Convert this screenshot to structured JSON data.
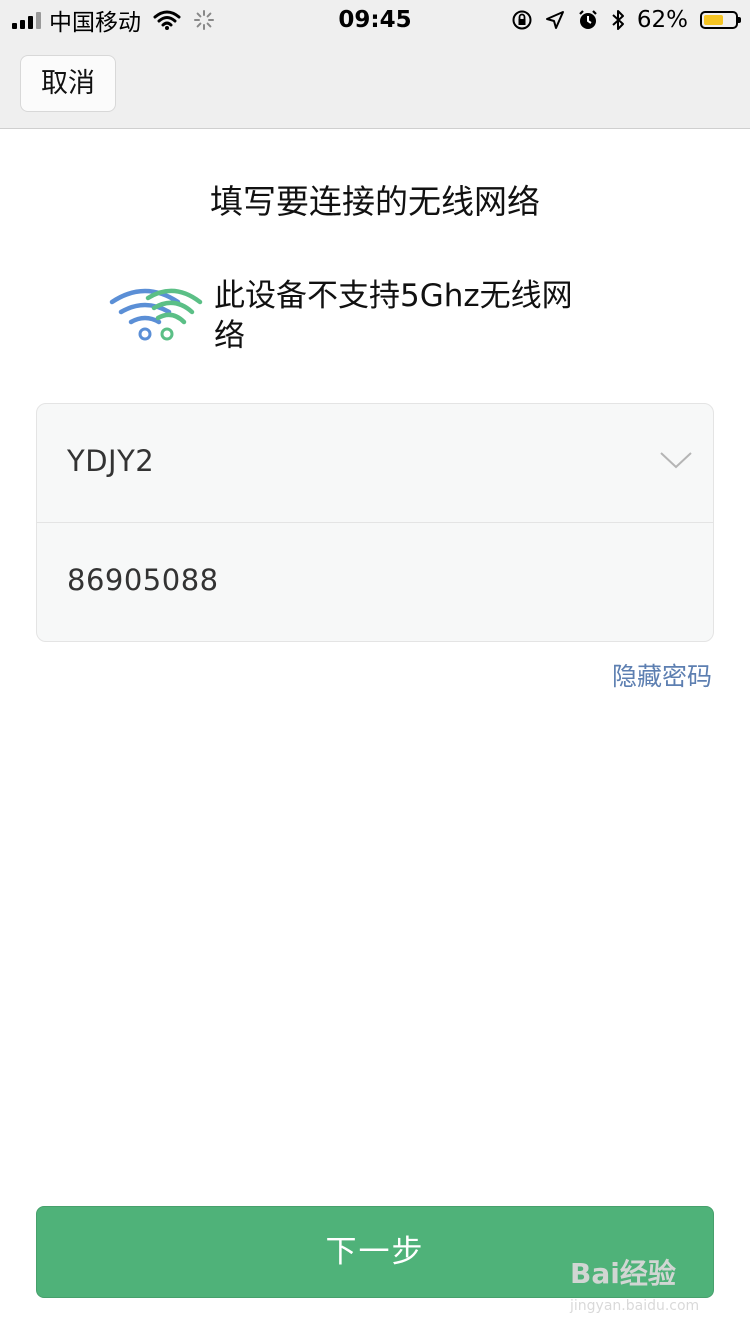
{
  "status_bar": {
    "carrier": "中国移动",
    "time": "09:45",
    "battery_percent": "62%",
    "battery_level": 0.62,
    "battery_color": "#f5c423"
  },
  "nav": {
    "cancel_label": "取消"
  },
  "main": {
    "title": "填写要连接的无线网络",
    "notice": "此设备不支持5Ghz无线网络",
    "ssid_value": "YDJY2",
    "password_value": "86905088",
    "toggle_password_label": "隐藏密码",
    "next_label": "下一步"
  },
  "watermark": {
    "brand": "Bai经验",
    "url": "jingyan.baidu.com"
  },
  "colors": {
    "accent_green": "#4fb279",
    "link_blue": "#5d7fb1",
    "wifi_blue": "#5b8fd6",
    "wifi_green": "#5bbf86"
  }
}
